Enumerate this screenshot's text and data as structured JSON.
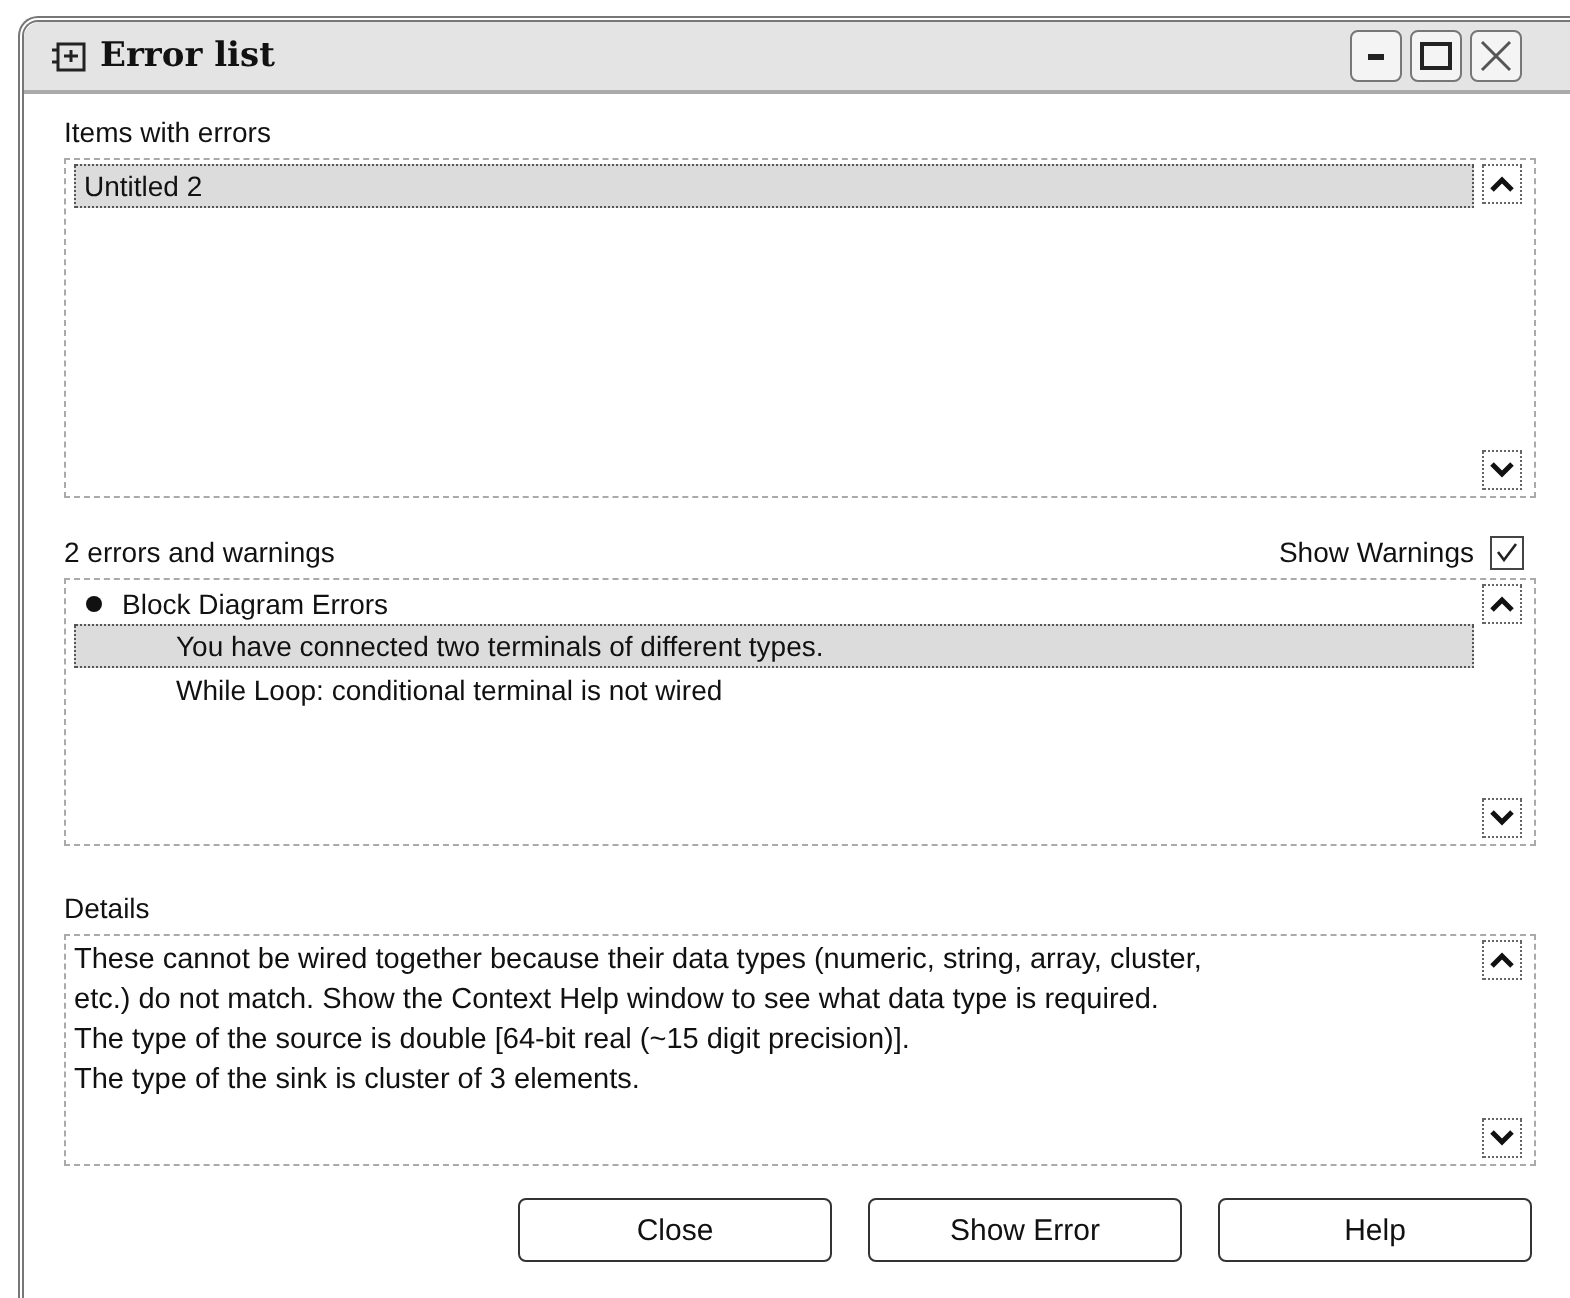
{
  "window": {
    "title": "Error list"
  },
  "items_section": {
    "label": "Items with errors",
    "items": [
      {
        "text": "Untitled 2",
        "selected": true
      }
    ]
  },
  "errors_section": {
    "summary": "2 errors and warnings",
    "show_warnings": {
      "label": "Show Warnings",
      "checked": true
    },
    "groups": [
      {
        "text": "Block Diagram Errors",
        "expanded": true,
        "children": [
          {
            "text": "You have connected two terminals of different types.",
            "selected": true
          },
          {
            "text": "While Loop: conditional terminal is not wired",
            "selected": false
          }
        ]
      }
    ]
  },
  "details": {
    "label": "Details",
    "lines": [
      "These cannot be wired together because their data types (numeric, string, array, cluster,",
      "etc.) do not match. Show the Context Help window to see what data type is required.",
      "The type of the source is double [64-bit real (~15 digit precision)].",
      "The type of the sink is cluster of 3 elements."
    ]
  },
  "buttons": [
    "Close",
    "Show Error",
    "Help"
  ]
}
